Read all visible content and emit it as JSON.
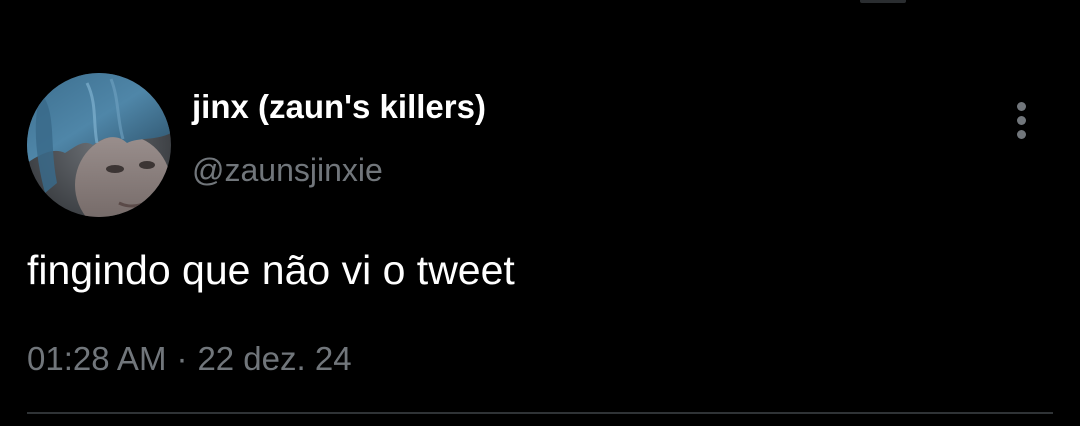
{
  "tweet": {
    "author": {
      "display_name": "jinx (zaun's killers)",
      "handle": "@zaunsjinxie",
      "avatar": "profile-photo"
    },
    "text": "fingindo que não vi o tweet",
    "time": "01:28 AM",
    "separator": "·",
    "date": "22 dez. 24",
    "menu_icon": "more-vertical-icon"
  },
  "colors": {
    "background": "#000000",
    "text_primary": "#ffffff",
    "text_secondary": "#71767b",
    "divider": "#2f3336"
  }
}
